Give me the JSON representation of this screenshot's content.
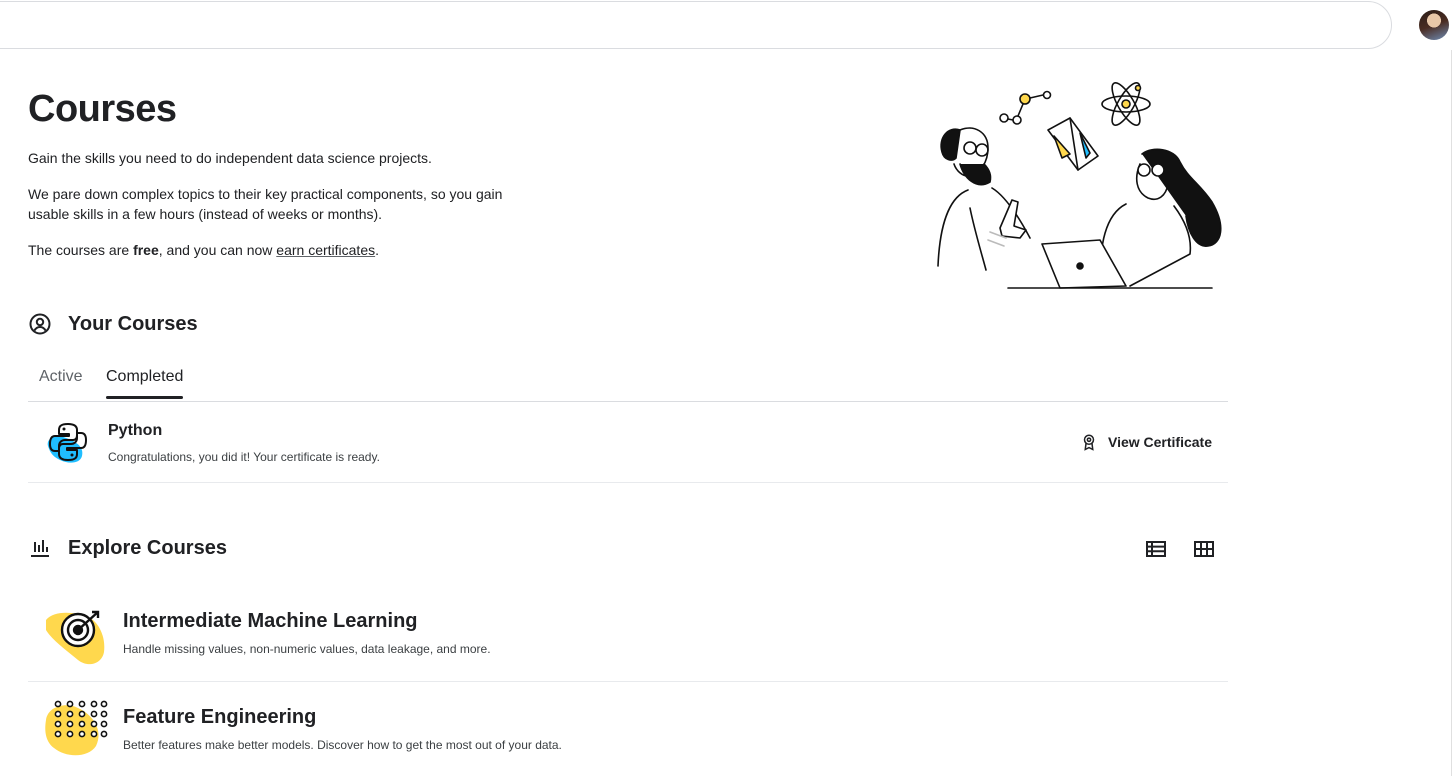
{
  "hero": {
    "title": "Courses",
    "p1": "Gain the skills you need to do independent data science projects.",
    "p2": "We pare down complex topics to their key practical components, so you gain usable skills in a few hours (instead of weeks or months).",
    "p3_before": "The courses are ",
    "p3_bold": "free",
    "p3_middle": ", and you can now ",
    "p3_link": "earn certificates",
    "p3_after": "."
  },
  "your_courses": {
    "title": "Your Courses",
    "tabs": [
      "Active",
      "Completed"
    ],
    "selected_tab": "Completed",
    "items": [
      {
        "title": "Python",
        "description": "Congratulations, you did it! Your certificate is ready.",
        "action": "View Certificate"
      }
    ]
  },
  "explore": {
    "title": "Explore Courses",
    "courses": [
      {
        "title": "Intermediate Machine Learning",
        "description": "Handle missing values, non-numeric values, data leakage, and more."
      },
      {
        "title": "Feature Engineering",
        "description": "Better features make better models. Discover how to get the most out of your data."
      }
    ]
  },
  "icons": {
    "your_courses": "account-circle-icon",
    "explore": "bar-chart-icon",
    "certificate": "award-icon",
    "list_view": "list-view-icon",
    "grid_view": "grid-view-icon"
  },
  "colors": {
    "accent_yellow": "#ffd84d",
    "python_blue": "#20beff",
    "text": "#202124"
  }
}
